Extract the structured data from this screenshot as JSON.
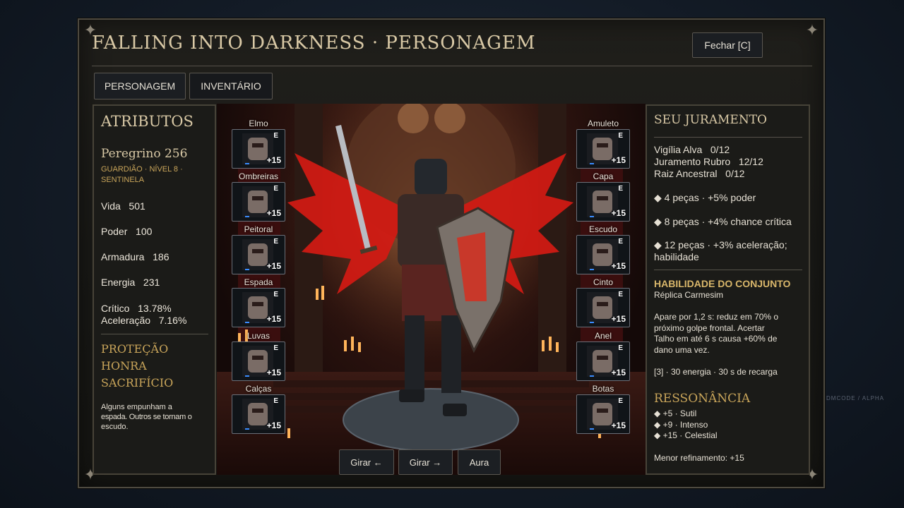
{
  "window": {
    "title": "FALLING INTO DARKNESS · PERSONAGEM",
    "close_button": "Fechar [C]",
    "watermark": "DMCODE / ALPHA"
  },
  "tabs": [
    "PERSONAGEM",
    "INVENTÁRIO"
  ],
  "attributes": {
    "heading": "ATRIBUTOS",
    "character_name": "Peregrino 256",
    "character_sub1": "GUARDIÃO · NÍVEL 8 ·",
    "character_sub2": "SENTINELA",
    "vida": "Vida   501",
    "poder": "Poder   100",
    "armadura": "Armadura   186",
    "energia": "Energia   231",
    "critico": "Crítico   13.78%",
    "aceleracao": "Aceleração   7.16%",
    "motto": [
      "PROTEÇÃO",
      "HONRA",
      "SACRIFÍCIO"
    ],
    "quote_line1": "Alguns empunham a",
    "quote_line2": "espada. Outros se tornam o",
    "quote_line3": "escudo."
  },
  "equipment_left": [
    {
      "label": "Elmo",
      "badge": "E",
      "plus": "+15",
      "icon": "helmet-icon"
    },
    {
      "label": "Ombreiras",
      "badge": "E",
      "plus": "+15",
      "icon": "pauldrons-icon"
    },
    {
      "label": "Peitoral",
      "badge": "E",
      "plus": "+15",
      "icon": "chestplate-icon"
    },
    {
      "label": "Espada",
      "badge": "E",
      "plus": "+15",
      "icon": "sword-icon"
    },
    {
      "label": "Luvas",
      "badge": "E",
      "plus": "+15",
      "icon": "gloves-icon"
    },
    {
      "label": "Calças",
      "badge": "E",
      "plus": "+15",
      "icon": "greaves-icon"
    }
  ],
  "equipment_right": [
    {
      "label": "Amuleto",
      "badge": "E",
      "plus": "+15",
      "icon": "amulet-icon"
    },
    {
      "label": "Capa",
      "badge": "E",
      "plus": "+15",
      "icon": "cape-icon"
    },
    {
      "label": "Escudo",
      "badge": "E",
      "plus": "+15",
      "icon": "shield-icon"
    },
    {
      "label": "Cinto",
      "badge": "E",
      "plus": "+15",
      "icon": "belt-icon"
    },
    {
      "label": "Anel",
      "badge": "E",
      "plus": "+15",
      "icon": "ring-icon"
    },
    {
      "label": "Botas",
      "badge": "E",
      "plus": "+15",
      "icon": "boots-icon"
    }
  ],
  "scene_buttons": [
    "Girar ←",
    "Girar →",
    "Aura"
  ],
  "oath": {
    "heading": "SEU JURAMENTO",
    "set1": "Vigília Alva   0/12",
    "set2": "Juramento Rubro   12/12",
    "set3": "Raiz Ancestral   0/12",
    "bonus1": "◆ 4 peças · +5% poder",
    "bonus2": "◆ 8 peças · +4% chance crítica",
    "bonus3a": "◆ 12 peças · +3% aceleração;",
    "bonus3b": "habilidade",
    "ability_heading": "HABILIDADE DO CONJUNTO",
    "ability_name": "Réplica Carmesim",
    "ability_desc1": "Apare por 1,2 s: reduz em 70% o",
    "ability_desc2": "próximo golpe frontal. Acertar",
    "ability_desc3": "Talho em até 6 s causa +60% de",
    "ability_desc4": "dano uma vez.",
    "ability_cost": "[3] · 30 energia · 30 s de recarga",
    "resonance_heading": "RESSONÂNCIA",
    "res1": "◆ +5 · Sutil",
    "res2": "◆ +9 · Intenso",
    "res3": "◆ +15 · Celestial",
    "min_refine": "Menor refinamento: +15"
  }
}
